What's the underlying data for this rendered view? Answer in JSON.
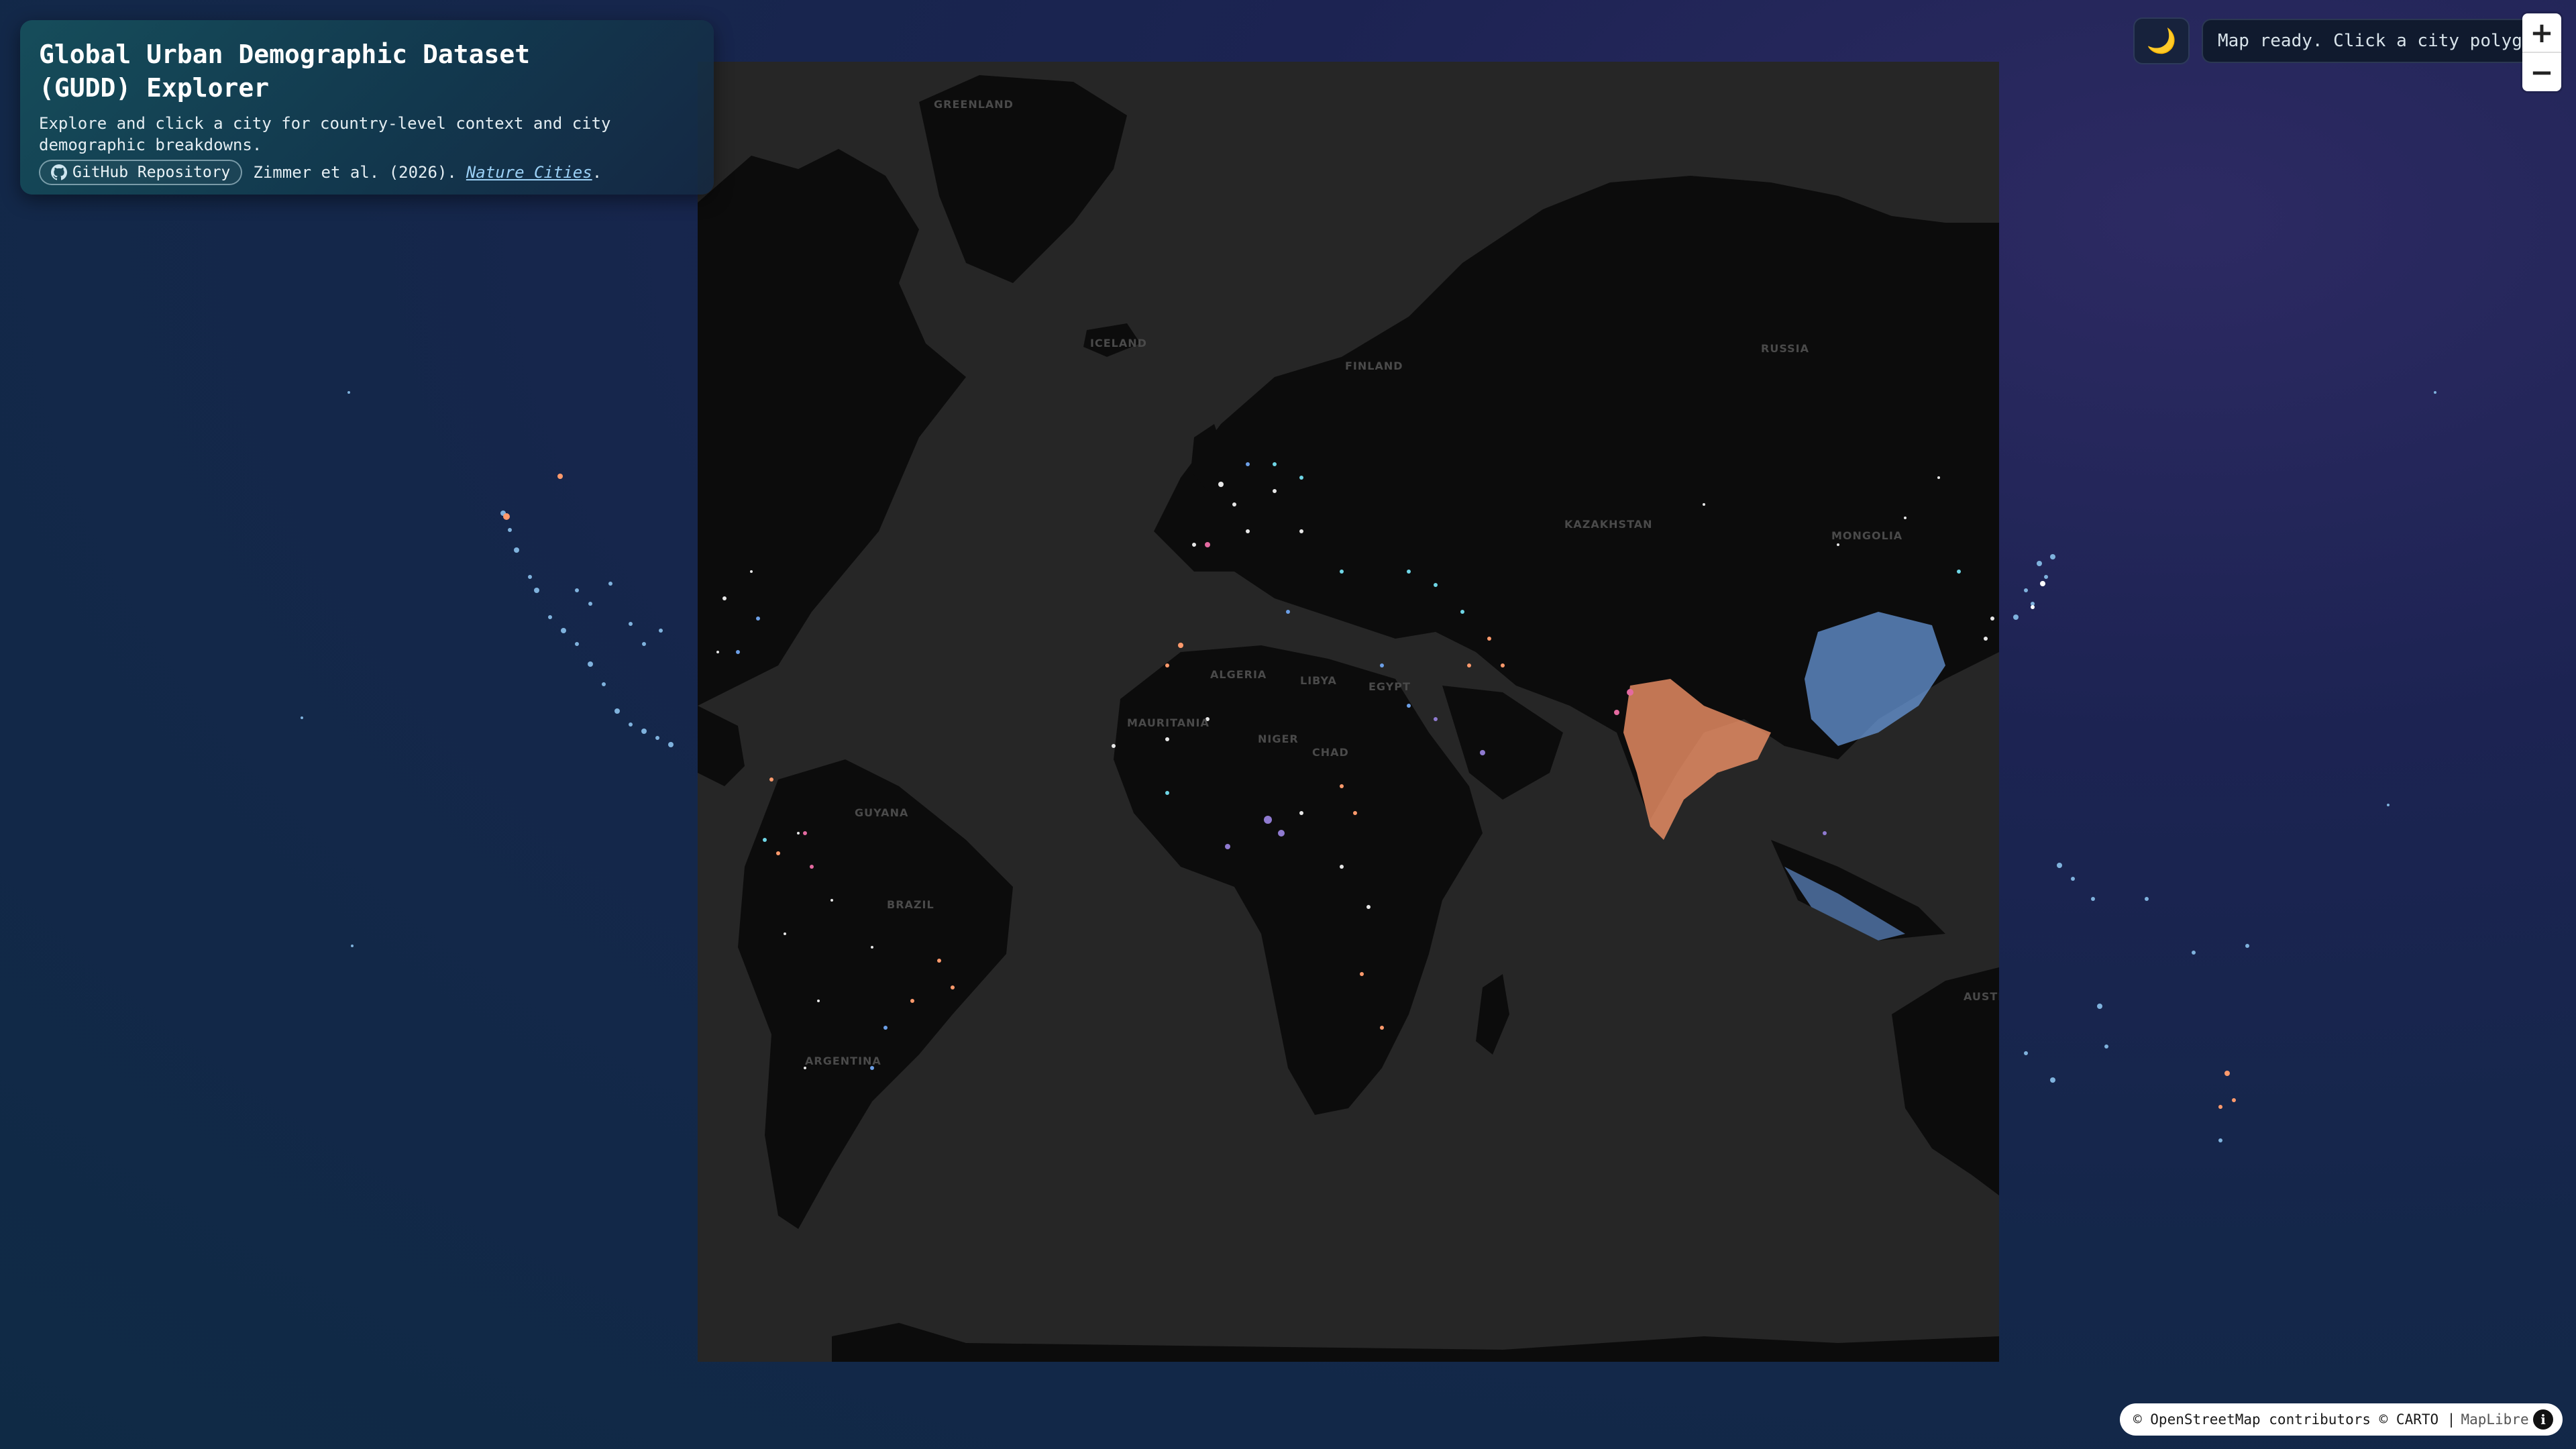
{
  "panel": {
    "title": "Global Urban Demographic Dataset (GUDD) Explorer",
    "description": "Explore and click a city for country-level context and city demographic breakdowns.",
    "github_button": "GitHub Repository",
    "citation": "Zimmer et al. (2026).",
    "journal": "Nature Cities",
    "citation_end": "."
  },
  "theme_toggle_icon": "🌙",
  "status": "Map ready. Click a city polygon",
  "zoom": {
    "in": "+",
    "out": "−"
  },
  "attribution": {
    "text": "© OpenStreetMap contributors © CARTO |",
    "maplibre": "MapLibre",
    "info_icon": "i"
  },
  "map_labels": {
    "greenland": "GREENLAND",
    "iceland": "ICELAND",
    "finland": "FINLAND",
    "russia": "RUSSIA",
    "kazakhstan": "KAZAKHSTAN",
    "mongolia": "MONGOLIA",
    "algeria": "ALGERIA",
    "libya": "LIBYA",
    "egypt": "EGYPT",
    "mauritania": "MAURITANIA",
    "niger": "NIGER",
    "chad": "CHAD",
    "brazil": "BRAZIL",
    "guyana": "GUYANA",
    "argentina": "ARGENTINA",
    "australia": "AUSTR"
  },
  "colors": {
    "map_background": "#262626",
    "land": "#0c0c0c",
    "dot_white": "#ffffff",
    "dot_orange": "#ff9a6c",
    "dot_blue": "#6c9fe6",
    "dot_cyan": "#6fd6e6",
    "dot_purple": "#8f7ad0",
    "dot_pink": "#e46aa0"
  }
}
